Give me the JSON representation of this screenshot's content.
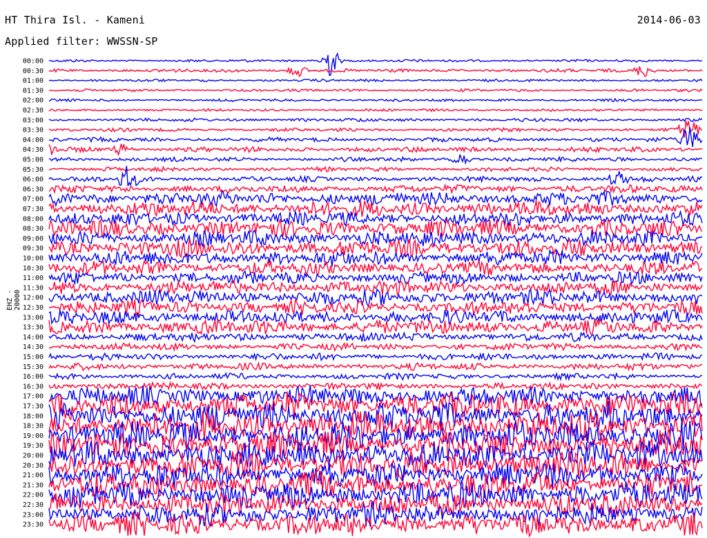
{
  "header": {
    "station": "HT Thira Isl. - Kameni",
    "date": "2014-06-03",
    "filter": "Applied filter: WWSSN-SP"
  },
  "channel_label": "EHZ - 20000",
  "colors": {
    "odd_trace": "#0000ee",
    "even_trace": "#ff0033"
  },
  "chart_data": {
    "type": "helicorder",
    "title": "HT Thira Isl. - Kameni",
    "date": "2014-06-03",
    "filter": "WWSSN-SP",
    "channel": "EHZ - 20000",
    "row_minutes": 30,
    "tick_labels": [
      "00:00",
      "00:30",
      "01:00",
      "01:30",
      "02:00",
      "02:30",
      "03:00",
      "03:30",
      "04:00",
      "04:30",
      "05:00",
      "05:30",
      "06:00",
      "06:30",
      "07:00",
      "07:30",
      "08:00",
      "08:30",
      "09:00",
      "09:30",
      "10:00",
      "10:30",
      "11:00",
      "11:30",
      "12:00",
      "12:30",
      "13:00",
      "13:30",
      "14:00",
      "14:30",
      "15:00",
      "15:30",
      "16:00",
      "16:30",
      "17:00",
      "17:30",
      "18:00",
      "18:30",
      "19:00",
      "19:30",
      "20:00",
      "20:30",
      "21:00",
      "21:30",
      "22:00",
      "22:30",
      "23:00",
      "23:30"
    ],
    "trace_amplitude": [
      0.3,
      0.4,
      0.3,
      0.3,
      0.3,
      0.3,
      0.4,
      0.4,
      0.5,
      0.6,
      0.5,
      0.5,
      0.6,
      0.9,
      1.6,
      1.8,
      1.6,
      2.0,
      1.8,
      2.0,
      1.8,
      1.6,
      1.4,
      1.6,
      1.8,
      1.6,
      1.6,
      1.7,
      1.0,
      0.8,
      0.8,
      0.8,
      0.7,
      0.8,
      2.2,
      3.0,
      3.2,
      3.4,
      3.4,
      3.2,
      3.2,
      3.2,
      3.0,
      3.0,
      3.0,
      2.6,
      2.6,
      2.6
    ],
    "events": [
      {
        "row": 0,
        "position": 0.43,
        "amplitude": 3.5
      },
      {
        "row": 1,
        "position": 0.38,
        "amplitude": 1.3
      },
      {
        "row": 1,
        "position": 0.91,
        "amplitude": 1.4
      },
      {
        "row": 9,
        "position": 0.0,
        "amplitude": 1.6
      },
      {
        "row": 9,
        "position": 0.11,
        "amplitude": 1.1
      },
      {
        "row": 10,
        "position": 0.63,
        "amplitude": 1.2
      },
      {
        "row": 8,
        "position": 0.98,
        "amplitude": 2.8
      },
      {
        "row": 7,
        "position": 0.98,
        "amplitude": 2.6
      },
      {
        "row": 12,
        "position": 0.12,
        "amplitude": 2.5
      },
      {
        "row": 12,
        "position": 0.87,
        "amplitude": 1.6
      }
    ]
  }
}
